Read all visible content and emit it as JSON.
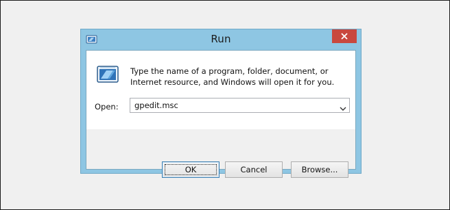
{
  "window": {
    "title": "Run",
    "close_icon": "close-icon",
    "app_icon": "run-icon"
  },
  "description": "Type the name of a program, folder, document, or Internet resource, and Windows will open it for you.",
  "open": {
    "label": "Open:",
    "value": "gpedit.msc"
  },
  "buttons": {
    "ok": "OK",
    "cancel": "Cancel",
    "browse": "Browse..."
  },
  "colors": {
    "frame": "#8ec6e3",
    "close": "#c9483e",
    "default_button_border": "#3c7fb1"
  }
}
